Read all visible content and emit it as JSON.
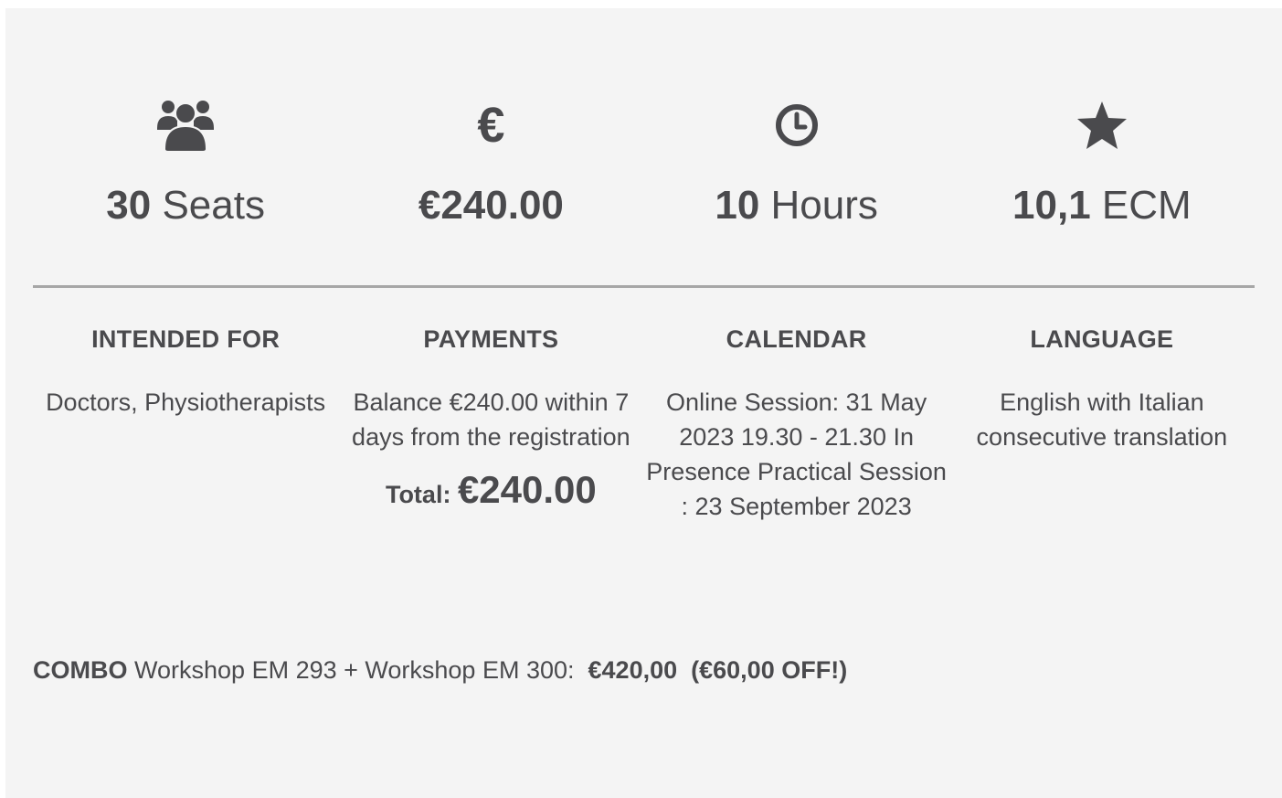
{
  "stats": [
    {
      "icon": "users-icon",
      "number": "30",
      "unit": "Seats"
    },
    {
      "icon": "euro-icon",
      "number": "€240.00",
      "unit": ""
    },
    {
      "icon": "clock-icon",
      "number": "10",
      "unit": "Hours"
    },
    {
      "icon": "star-icon",
      "number": "10,1",
      "unit": "ECM"
    }
  ],
  "euro_symbol": "€",
  "info": [
    {
      "heading": "INTENDED FOR",
      "text": "Doctors, Physiotherapists"
    },
    {
      "heading": "PAYMENTS",
      "text": "Balance €240.00 within 7 days from the registration",
      "total_label": "Total:",
      "total_value": "€240.00"
    },
    {
      "heading": "CALENDAR",
      "text": "Online Session: 31 May 2023 19.30 - 21.30 In Presence Practical Session : 23 September 2023"
    },
    {
      "heading": "LANGUAGE",
      "text": "English with Italian consecutive translation"
    }
  ],
  "combo": {
    "label": "COMBO",
    "text": "Workshop EM 293 + Workshop EM 300:",
    "price": "€420,00",
    "discount": "(€60,00 OFF!)"
  },
  "colors": {
    "panel_bg": "#f4f4f4",
    "text": "#4a4a4d",
    "divider": "#a6a6a6"
  }
}
